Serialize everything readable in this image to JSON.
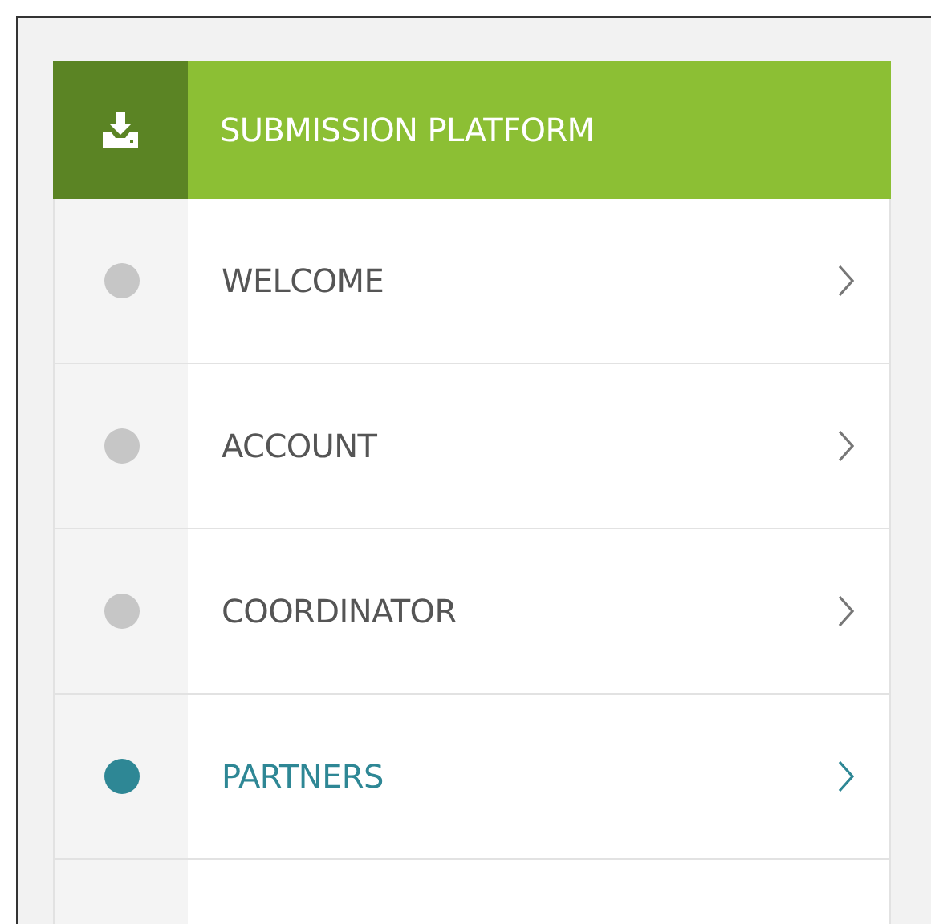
{
  "menu": {
    "title": "SUBMISSION PLATFORM",
    "items": [
      {
        "label": "WELCOME",
        "selected": false
      },
      {
        "label": "ACCOUNT",
        "selected": false
      },
      {
        "label": "COORDINATOR",
        "selected": false
      },
      {
        "label": "PARTNERS",
        "selected": true
      }
    ]
  }
}
